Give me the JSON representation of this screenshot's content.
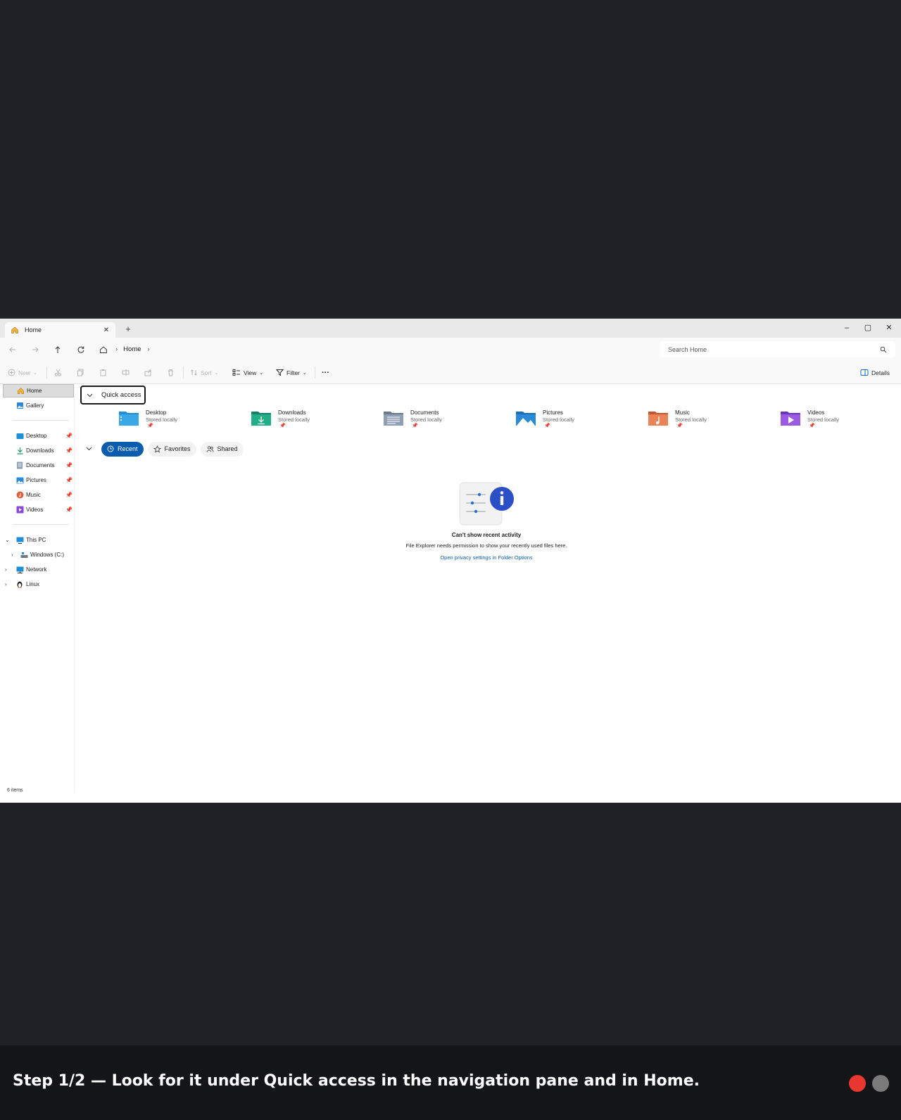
{
  "window": {
    "tab_title": "Home",
    "new_tab": "+",
    "close_tab": "✕",
    "minimize": "–",
    "maximize": "▢",
    "close": "✕"
  },
  "address": {
    "breadcrumb_home": "Home",
    "separator": "›",
    "search_placeholder": "Search Home"
  },
  "toolbar": {
    "new_label": "New",
    "sort_label": "Sort",
    "view_label": "View",
    "filter_label": "Filter",
    "more_label": "···",
    "details_label": "Details"
  },
  "nav": {
    "home": "Home",
    "gallery": "Gallery",
    "pinned": [
      {
        "label": "Desktop"
      },
      {
        "label": "Downloads"
      },
      {
        "label": "Documents"
      },
      {
        "label": "Pictures"
      },
      {
        "label": "Music"
      },
      {
        "label": "Videos"
      }
    ],
    "this_pc": "This PC",
    "windows_c": "Windows (C:)",
    "network": "Network",
    "linux": "Linux"
  },
  "quick_access": {
    "heading": "Quick access",
    "folders": [
      {
        "name": "Desktop",
        "status": "Stored locally",
        "color": "#1e8fd6"
      },
      {
        "name": "Downloads",
        "status": "Stored locally",
        "color": "#1a9a6e"
      },
      {
        "name": "Documents",
        "status": "Stored locally",
        "color": "#7a8a9a"
      },
      {
        "name": "Pictures",
        "status": "Stored locally",
        "color": "#2a8ad8"
      },
      {
        "name": "Music",
        "status": "Stored locally",
        "color": "#e07a4a"
      },
      {
        "name": "Videos",
        "status": "Stored locally",
        "color": "#8a4ad8"
      }
    ]
  },
  "recent_tabs": {
    "recent": "Recent",
    "favorites": "Favorites",
    "shared": "Shared"
  },
  "empty_state": {
    "title": "Can't show recent activity",
    "message": "File Explorer needs permission to show your recently used files here.",
    "link": "Open privacy settings in Folder Options"
  },
  "status_bar": {
    "count": "6 items"
  },
  "caption": {
    "text": "Step 1/2 — Look for it under Quick access in the navigation pane and in Home.",
    "dot_colors": [
      "#e8372f",
      "#7a7a7a"
    ]
  },
  "colors": {
    "accent": "#0b5cad",
    "background": "#202126"
  }
}
